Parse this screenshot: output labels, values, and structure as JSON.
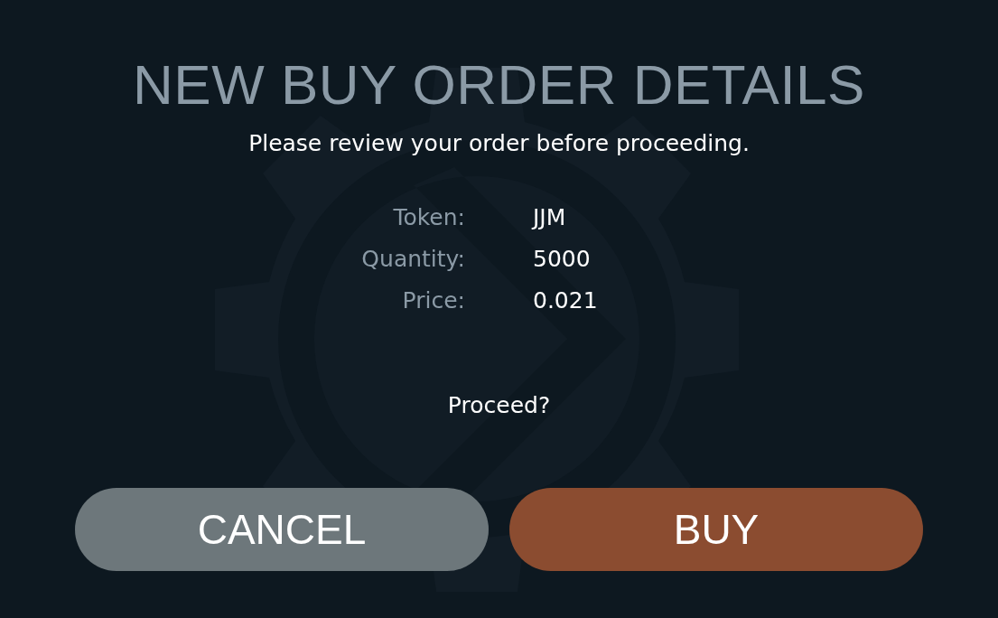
{
  "title": "NEW BUY ORDER DETAILS",
  "subtitle": "Please review your order before proceeding.",
  "details": [
    {
      "label": "Token:",
      "value": "JJM"
    },
    {
      "label": "Quantity:",
      "value": "5000"
    },
    {
      "label": "Price:",
      "value": "0.021"
    }
  ],
  "prompt": "Proceed?",
  "buttons": [
    {
      "kind": "cancel",
      "label": "CANCEL"
    },
    {
      "kind": "buy",
      "label": "BUY"
    }
  ]
}
